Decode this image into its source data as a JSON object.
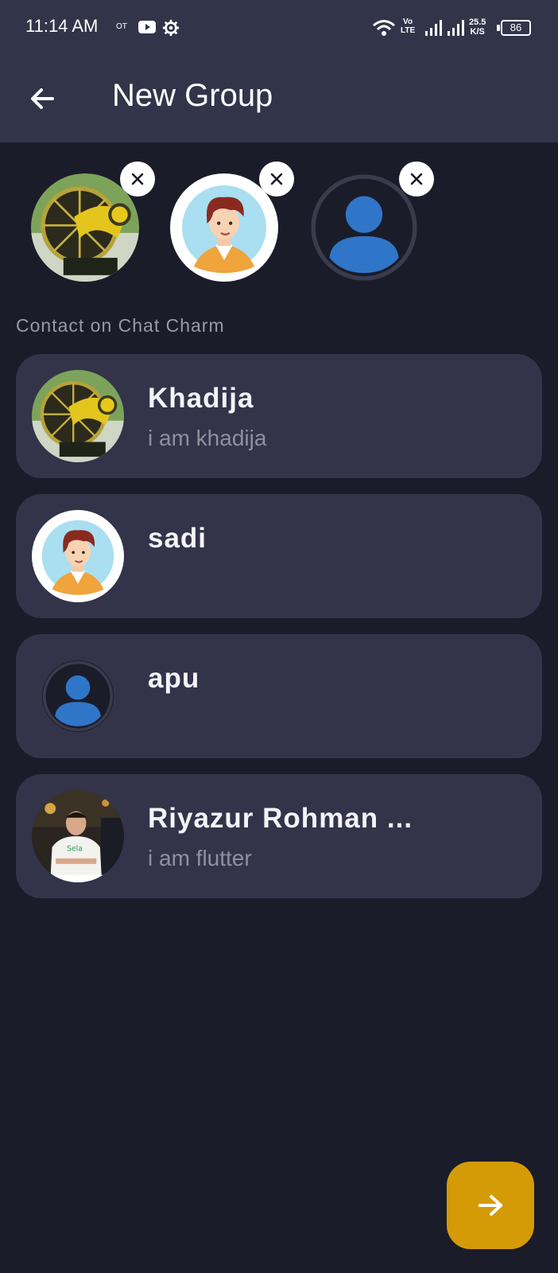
{
  "status_bar": {
    "time": "11:14 AM",
    "ot": "OT",
    "volte_line1": "Vo",
    "volte_line2": "LTE",
    "speed_value": "25.5",
    "speed_unit": "K/S",
    "battery": "86"
  },
  "appbar": {
    "title": "New Group",
    "back_icon": "arrow-left-icon"
  },
  "selected_members": [
    {
      "avatar": "photo-fan",
      "remove_icon": "close-icon"
    },
    {
      "avatar": "cartoon-boy",
      "remove_icon": "close-icon"
    },
    {
      "avatar": "default-person",
      "remove_icon": "close-icon"
    }
  ],
  "section_label": "Contact on Chat Charm",
  "contacts": [
    {
      "name": "Khadija",
      "status": "i am khadija",
      "avatar": "photo-fan"
    },
    {
      "name": "sadi",
      "status": "",
      "avatar": "cartoon-boy"
    },
    {
      "name": "apu",
      "status": "",
      "avatar": "default-person"
    },
    {
      "name": "Riyazur Rohman ...",
      "status": "i am flutter",
      "avatar": "photo-person"
    }
  ],
  "fab": {
    "icon": "arrow-right-icon"
  },
  "colors": {
    "background": "#1b1c2a",
    "appbar": "#32344a",
    "card": "#33344a",
    "fab": "#d49b07",
    "default_avatar_blue": "#2f76c8"
  }
}
